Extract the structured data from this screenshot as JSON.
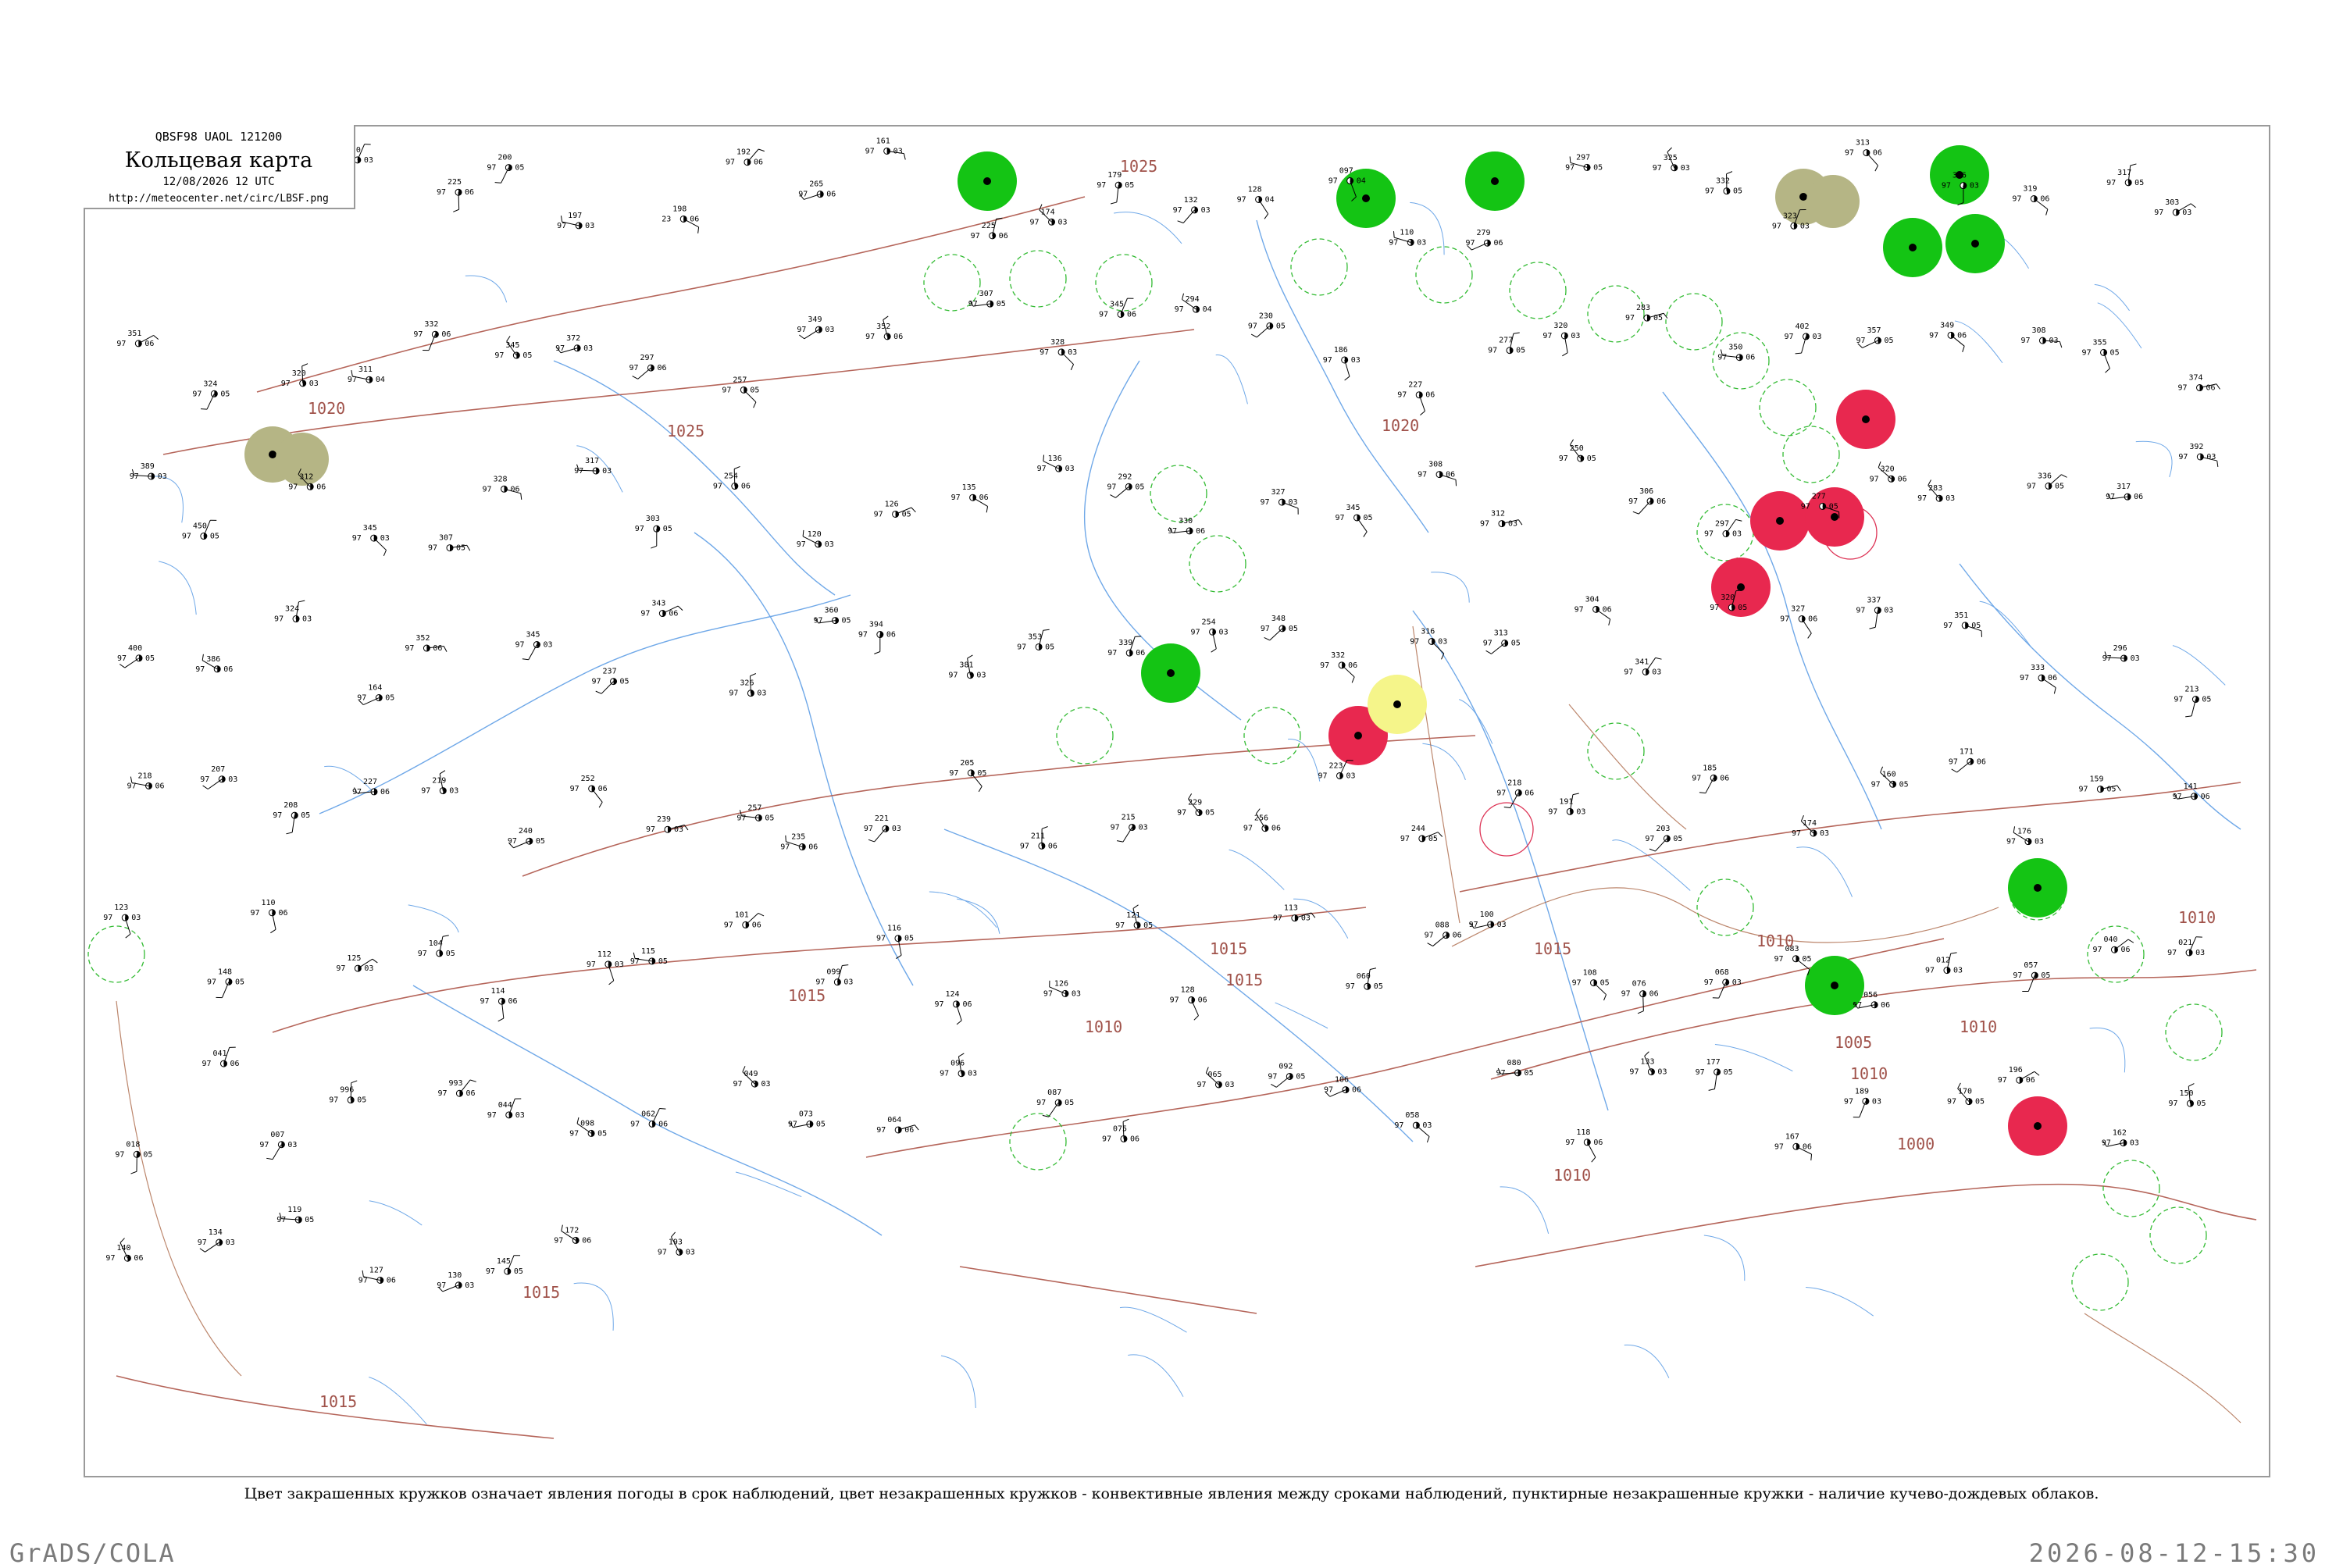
{
  "header": {
    "code": "QBSF98  UAOL  121200",
    "title": "Кольцевая карта",
    "date": "12/08/2026 12 UTC",
    "url": "http://meteocenter.net/circ/LBSF.png"
  },
  "legend_caption": "Цвет закрашенных кружков означает явления погоды в срок наблюдений, цвет незакрашенных кружков - конвективные явления между сроками наблюдений, пунктирные незакрашенные кружки - наличие кучево-дождевых облаков.",
  "footer": {
    "left": "GrADS/COLA",
    "right": "2026-08-12-15:30"
  },
  "colors": {
    "isobar": "#b5655a",
    "river": "#6fa8e8",
    "boundary": "#a0522d",
    "rain_fill": "#14c414",
    "thunder_fill": "#e8284f",
    "fog_fill": "#f5f58a",
    "haze_fill": "#b5b585",
    "cb_ring": "#33bb33",
    "thunder_ring": "#dd3355"
  },
  "isobar_labels": [
    "1025",
    "1020",
    "1025",
    "1020",
    "1015",
    "1015",
    "1010",
    "1015",
    "1010",
    "1010",
    "1010",
    "1005",
    "1000",
    "1015",
    "1010",
    "1010",
    "1015",
    "1015"
  ],
  "stations": [
    {
      "p": "226",
      "t": "19",
      "n": "03"
    },
    {
      "p": "239",
      "t": "97",
      "n": "06"
    },
    {
      "p": "235",
      "t": "97",
      "n": "05"
    },
    {
      "p": "220",
      "t": "97",
      "n": "03"
    },
    {
      "p": "225",
      "t": "97",
      "n": "06"
    },
    {
      "p": "200",
      "t": "97",
      "n": "05"
    },
    {
      "p": "197",
      "t": "97",
      "n": "03"
    },
    {
      "p": "198",
      "t": "23",
      "n": "06"
    },
    {
      "p": "192",
      "t": "97",
      "n": "06"
    },
    {
      "p": "265",
      "t": "97",
      "n": "06"
    },
    {
      "p": "161",
      "t": "97",
      "n": "03"
    },
    {
      "p": "225",
      "t": "97",
      "n": "06"
    },
    {
      "p": "174",
      "t": "97",
      "n": "03"
    },
    {
      "p": "179",
      "t": "97",
      "n": "05"
    },
    {
      "p": "132",
      "t": "97",
      "n": "03"
    },
    {
      "p": "128",
      "t": "97",
      "n": "04"
    },
    {
      "p": "097",
      "t": "97",
      "n": "04"
    },
    {
      "p": "110",
      "t": "97",
      "n": "03"
    },
    {
      "p": "279",
      "t": "97",
      "n": "06"
    },
    {
      "p": "297",
      "t": "97",
      "n": "05"
    },
    {
      "p": "325",
      "t": "97",
      "n": "03"
    },
    {
      "p": "332",
      "t": "97",
      "n": "05"
    },
    {
      "p": "323",
      "t": "97",
      "n": "03"
    },
    {
      "p": "313",
      "t": "97",
      "n": "06"
    },
    {
      "p": "316",
      "t": "97",
      "n": "03"
    },
    {
      "p": "319",
      "t": "97",
      "n": "06"
    },
    {
      "p": "317",
      "t": "97",
      "n": "05"
    },
    {
      "p": "303",
      "t": "97",
      "n": "03"
    },
    {
      "p": "351",
      "t": "97",
      "n": "06"
    },
    {
      "p": "324",
      "t": "97",
      "n": "05"
    },
    {
      "p": "320",
      "t": "97",
      "n": "03"
    },
    {
      "p": "311",
      "t": "97",
      "n": "04"
    },
    {
      "p": "332",
      "t": "97",
      "n": "06"
    },
    {
      "p": "345",
      "t": "97",
      "n": "05"
    },
    {
      "p": "372",
      "t": "97",
      "n": "03"
    },
    {
      "p": "297",
      "t": "97",
      "n": "06"
    },
    {
      "p": "257",
      "t": "97",
      "n": "05"
    },
    {
      "p": "349",
      "t": "97",
      "n": "03"
    },
    {
      "p": "352",
      "t": "97",
      "n": "06"
    },
    {
      "p": "307",
      "t": "97",
      "n": "05"
    },
    {
      "p": "328",
      "t": "97",
      "n": "03"
    },
    {
      "p": "345",
      "t": "97",
      "n": "06"
    },
    {
      "p": "294",
      "t": "97",
      "n": "04"
    },
    {
      "p": "230",
      "t": "97",
      "n": "05"
    },
    {
      "p": "186",
      "t": "97",
      "n": "03"
    },
    {
      "p": "227",
      "t": "97",
      "n": "06"
    },
    {
      "p": "277",
      "t": "97",
      "n": "05"
    },
    {
      "p": "320",
      "t": "97",
      "n": "03"
    },
    {
      "p": "283",
      "t": "97",
      "n": "05"
    },
    {
      "p": "350",
      "t": "97",
      "n": "06"
    },
    {
      "p": "402",
      "t": "97",
      "n": "03"
    },
    {
      "p": "357",
      "t": "97",
      "n": "05"
    },
    {
      "p": "349",
      "t": "97",
      "n": "06"
    },
    {
      "p": "308",
      "t": "97",
      "n": "03"
    },
    {
      "p": "355",
      "t": "97",
      "n": "05"
    },
    {
      "p": "374",
      "t": "97",
      "n": "06"
    },
    {
      "p": "389",
      "t": "97",
      "n": "03"
    },
    {
      "p": "450",
      "t": "97",
      "n": "05"
    },
    {
      "p": "312",
      "t": "97",
      "n": "06"
    },
    {
      "p": "345",
      "t": "97",
      "n": "03"
    },
    {
      "p": "307",
      "t": "97",
      "n": "05"
    },
    {
      "p": "328",
      "t": "97",
      "n": "06"
    },
    {
      "p": "317",
      "t": "97",
      "n": "03"
    },
    {
      "p": "303",
      "t": "97",
      "n": "05"
    },
    {
      "p": "254",
      "t": "97",
      "n": "06"
    },
    {
      "p": "120",
      "t": "97",
      "n": "03"
    },
    {
      "p": "126",
      "t": "97",
      "n": "05"
    },
    {
      "p": "135",
      "t": "97",
      "n": "06"
    },
    {
      "p": "136",
      "t": "97",
      "n": "03"
    },
    {
      "p": "292",
      "t": "97",
      "n": "05"
    },
    {
      "p": "330",
      "t": "97",
      "n": "06"
    },
    {
      "p": "327",
      "t": "97",
      "n": "03"
    },
    {
      "p": "345",
      "t": "97",
      "n": "05"
    },
    {
      "p": "308",
      "t": "97",
      "n": "06"
    },
    {
      "p": "312",
      "t": "97",
      "n": "03"
    },
    {
      "p": "250",
      "t": "97",
      "n": "05"
    },
    {
      "p": "306",
      "t": "97",
      "n": "06"
    },
    {
      "p": "297",
      "t": "97",
      "n": "03"
    },
    {
      "p": "277",
      "t": "97",
      "n": "05"
    },
    {
      "p": "320",
      "t": "97",
      "n": "06"
    },
    {
      "p": "283",
      "t": "97",
      "n": "03"
    },
    {
      "p": "336",
      "t": "97",
      "n": "05"
    },
    {
      "p": "317",
      "t": "97",
      "n": "06"
    },
    {
      "p": "392",
      "t": "97",
      "n": "03"
    },
    {
      "p": "400",
      "t": "97",
      "n": "05"
    },
    {
      "p": "386",
      "t": "97",
      "n": "06"
    },
    {
      "p": "324",
      "t": "97",
      "n": "03"
    },
    {
      "p": "164",
      "t": "97",
      "n": "05"
    },
    {
      "p": "352",
      "t": "97",
      "n": "06"
    },
    {
      "p": "345",
      "t": "97",
      "n": "03"
    },
    {
      "p": "237",
      "t": "97",
      "n": "05"
    },
    {
      "p": "343",
      "t": "97",
      "n": "06"
    },
    {
      "p": "326",
      "t": "97",
      "n": "03"
    },
    {
      "p": "360",
      "t": "97",
      "n": "05"
    },
    {
      "p": "394",
      "t": "97",
      "n": "06"
    },
    {
      "p": "381",
      "t": "97",
      "n": "03"
    },
    {
      "p": "353",
      "t": "97",
      "n": "05"
    },
    {
      "p": "339",
      "t": "97",
      "n": "06"
    },
    {
      "p": "254",
      "t": "97",
      "n": "03"
    },
    {
      "p": "348",
      "t": "97",
      "n": "05"
    },
    {
      "p": "332",
      "t": "97",
      "n": "06"
    },
    {
      "p": "316",
      "t": "97",
      "n": "03"
    },
    {
      "p": "313",
      "t": "97",
      "n": "05"
    },
    {
      "p": "304",
      "t": "97",
      "n": "06"
    },
    {
      "p": "341",
      "t": "97",
      "n": "03"
    },
    {
      "p": "320",
      "t": "97",
      "n": "05"
    },
    {
      "p": "327",
      "t": "97",
      "n": "06"
    },
    {
      "p": "337",
      "t": "97",
      "n": "03"
    },
    {
      "p": "351",
      "t": "97",
      "n": "05"
    },
    {
      "p": "333",
      "t": "97",
      "n": "06"
    },
    {
      "p": "296",
      "t": "97",
      "n": "03"
    },
    {
      "p": "213",
      "t": "97",
      "n": "05"
    },
    {
      "p": "218",
      "t": "97",
      "n": "06"
    },
    {
      "p": "207",
      "t": "97",
      "n": "03"
    },
    {
      "p": "208",
      "t": "97",
      "n": "05"
    },
    {
      "p": "227",
      "t": "97",
      "n": "06"
    },
    {
      "p": "219",
      "t": "97",
      "n": "03"
    },
    {
      "p": "240",
      "t": "97",
      "n": "05"
    },
    {
      "p": "252",
      "t": "97",
      "n": "06"
    },
    {
      "p": "239",
      "t": "97",
      "n": "03"
    },
    {
      "p": "257",
      "t": "97",
      "n": "05"
    },
    {
      "p": "235",
      "t": "97",
      "n": "06"
    },
    {
      "p": "221",
      "t": "97",
      "n": "03"
    },
    {
      "p": "205",
      "t": "97",
      "n": "05"
    },
    {
      "p": "211",
      "t": "97",
      "n": "06"
    },
    {
      "p": "215",
      "t": "97",
      "n": "03"
    },
    {
      "p": "229",
      "t": "97",
      "n": "05"
    },
    {
      "p": "256",
      "t": "97",
      "n": "06"
    },
    {
      "p": "223",
      "t": "97",
      "n": "03"
    },
    {
      "p": "244",
      "t": "97",
      "n": "05"
    },
    {
      "p": "218",
      "t": "97",
      "n": "06"
    },
    {
      "p": "191",
      "t": "97",
      "n": "03"
    },
    {
      "p": "203",
      "t": "97",
      "n": "05"
    },
    {
      "p": "185",
      "t": "97",
      "n": "06"
    },
    {
      "p": "174",
      "t": "97",
      "n": "03"
    },
    {
      "p": "160",
      "t": "97",
      "n": "05"
    },
    {
      "p": "171",
      "t": "97",
      "n": "06"
    },
    {
      "p": "176",
      "t": "97",
      "n": "03"
    },
    {
      "p": "159",
      "t": "97",
      "n": "05"
    },
    {
      "p": "141",
      "t": "97",
      "n": "06"
    },
    {
      "p": "123",
      "t": "97",
      "n": "03"
    },
    {
      "p": "148",
      "t": "97",
      "n": "05"
    },
    {
      "p": "110",
      "t": "97",
      "n": "06"
    },
    {
      "p": "125",
      "t": "97",
      "n": "03"
    },
    {
      "p": "104",
      "t": "97",
      "n": "05"
    },
    {
      "p": "114",
      "t": "97",
      "n": "06"
    },
    {
      "p": "112",
      "t": "97",
      "n": "03"
    },
    {
      "p": "115",
      "t": "97",
      "n": "05"
    },
    {
      "p": "101",
      "t": "97",
      "n": "06"
    },
    {
      "p": "099",
      "t": "97",
      "n": "03"
    },
    {
      "p": "116",
      "t": "97",
      "n": "05"
    },
    {
      "p": "124",
      "t": "97",
      "n": "06"
    },
    {
      "p": "126",
      "t": "97",
      "n": "03"
    },
    {
      "p": "121",
      "t": "97",
      "n": "05"
    },
    {
      "p": "128",
      "t": "97",
      "n": "06"
    },
    {
      "p": "113",
      "t": "97",
      "n": "03"
    },
    {
      "p": "060",
      "t": "97",
      "n": "05"
    },
    {
      "p": "088",
      "t": "97",
      "n": "06"
    },
    {
      "p": "100",
      "t": "97",
      "n": "03"
    },
    {
      "p": "108",
      "t": "97",
      "n": "05"
    },
    {
      "p": "076",
      "t": "97",
      "n": "06"
    },
    {
      "p": "068",
      "t": "97",
      "n": "03"
    },
    {
      "p": "083",
      "t": "97",
      "n": "05"
    },
    {
      "p": "056",
      "t": "97",
      "n": "06"
    },
    {
      "p": "012",
      "t": "97",
      "n": "03"
    },
    {
      "p": "057",
      "t": "97",
      "n": "05"
    },
    {
      "p": "040",
      "t": "97",
      "n": "06"
    },
    {
      "p": "021",
      "t": "97",
      "n": "03"
    },
    {
      "p": "018",
      "t": "97",
      "n": "05"
    },
    {
      "p": "041",
      "t": "97",
      "n": "06"
    },
    {
      "p": "007",
      "t": "97",
      "n": "03"
    },
    {
      "p": "996",
      "t": "97",
      "n": "05"
    },
    {
      "p": "993",
      "t": "97",
      "n": "06"
    },
    {
      "p": "044",
      "t": "97",
      "n": "03"
    },
    {
      "p": "098",
      "t": "97",
      "n": "05"
    },
    {
      "p": "062",
      "t": "97",
      "n": "06"
    },
    {
      "p": "049",
      "t": "97",
      "n": "03"
    },
    {
      "p": "073",
      "t": "97",
      "n": "05"
    },
    {
      "p": "064",
      "t": "97",
      "n": "06"
    },
    {
      "p": "096",
      "t": "97",
      "n": "03"
    },
    {
      "p": "087",
      "t": "97",
      "n": "05"
    },
    {
      "p": "075",
      "t": "97",
      "n": "06"
    },
    {
      "p": "065",
      "t": "97",
      "n": "03"
    },
    {
      "p": "092",
      "t": "97",
      "n": "05"
    },
    {
      "p": "106",
      "t": "97",
      "n": "06"
    },
    {
      "p": "058",
      "t": "97",
      "n": "03"
    },
    {
      "p": "080",
      "t": "97",
      "n": "05"
    },
    {
      "p": "118",
      "t": "97",
      "n": "06"
    },
    {
      "p": "133",
      "t": "97",
      "n": "03"
    },
    {
      "p": "177",
      "t": "97",
      "n": "05"
    },
    {
      "p": "167",
      "t": "97",
      "n": "06"
    },
    {
      "p": "189",
      "t": "97",
      "n": "03"
    },
    {
      "p": "170",
      "t": "97",
      "n": "05"
    },
    {
      "p": "196",
      "t": "97",
      "n": "06"
    },
    {
      "p": "162",
      "t": "97",
      "n": "03"
    },
    {
      "p": "150",
      "t": "97",
      "n": "05"
    },
    {
      "p": "140",
      "t": "97",
      "n": "06"
    },
    {
      "p": "134",
      "t": "97",
      "n": "03"
    },
    {
      "p": "119",
      "t": "97",
      "n": "05"
    },
    {
      "p": "127",
      "t": "97",
      "n": "06"
    },
    {
      "p": "130",
      "t": "97",
      "n": "03"
    },
    {
      "p": "145",
      "t": "97",
      "n": "05"
    },
    {
      "p": "172",
      "t": "97",
      "n": "06"
    },
    {
      "p": "193",
      "t": "97",
      "n": "03"
    }
  ],
  "weather_markers": [
    {
      "kind": "rain",
      "label": "rain-marker"
    },
    {
      "kind": "rain",
      "label": "rain-marker"
    },
    {
      "kind": "rain",
      "label": "rain-marker"
    },
    {
      "kind": "rain",
      "label": "rain-marker"
    },
    {
      "kind": "rain",
      "label": "rain-marker"
    },
    {
      "kind": "rain",
      "label": "rain-marker"
    },
    {
      "kind": "rain",
      "label": "rain-marker"
    },
    {
      "kind": "rain",
      "label": "rain-marker"
    },
    {
      "kind": "rain",
      "label": "rain-marker"
    },
    {
      "kind": "thunder",
      "label": "thunder-marker"
    },
    {
      "kind": "thunder",
      "label": "thunder-marker"
    },
    {
      "kind": "thunder",
      "label": "thunder-marker"
    },
    {
      "kind": "thunder",
      "label": "thunder-marker"
    },
    {
      "kind": "thunder",
      "label": "thunder-marker"
    },
    {
      "kind": "thunder",
      "label": "thunder-marker"
    },
    {
      "kind": "fog",
      "label": "fog-marker"
    },
    {
      "kind": "haze",
      "label": "haze-marker"
    },
    {
      "kind": "haze",
      "label": "haze-marker"
    }
  ]
}
